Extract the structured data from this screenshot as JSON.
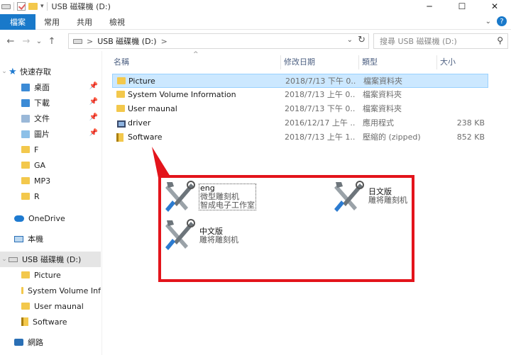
{
  "window": {
    "title": "USB 磁碟機 (D:)",
    "minimize": "─",
    "maximize": "☐",
    "close": "✕"
  },
  "ribbon": {
    "tabs": [
      "檔案",
      "常用",
      "共用",
      "檢視"
    ]
  },
  "nav": {
    "back": "←",
    "forward": "→",
    "recent": "⌄",
    "up": "↑",
    "address_label": "USB 磁碟機 (D:)",
    "address_sep": ">",
    "search_placeholder": "搜尋 USB 磁碟機 (D:)"
  },
  "sidebar": {
    "quick_access": "快速存取",
    "items": [
      "桌面",
      "下載",
      "文件",
      "圖片",
      "F",
      "GA",
      "MP3",
      "R"
    ],
    "onedrive": "OneDrive",
    "this_pc": "本機",
    "usb": "USB 磁碟機 (D:)",
    "usb_children": [
      "Picture",
      "System Volume Inf",
      "User maunal",
      "Software"
    ],
    "network": "網路"
  },
  "columns": {
    "name": "名稱",
    "date": "修改日期",
    "type": "類型",
    "size": "大小"
  },
  "files": [
    {
      "name": "Picture",
      "date": "2018/7/13 下午 0...",
      "type": "檔案資料夾",
      "size": "",
      "icon": "folder-icon"
    },
    {
      "name": "System Volume Information",
      "date": "2018/7/13 上午 0...",
      "type": "檔案資料夾",
      "size": "",
      "icon": "folder-icon"
    },
    {
      "name": "User maunal",
      "date": "2018/7/13 下午 0...",
      "type": "檔案資料夾",
      "size": "",
      "icon": "folder-icon"
    },
    {
      "name": "driver",
      "date": "2016/12/17 上午 ...",
      "type": "應用程式",
      "size": "238 KB",
      "icon": "application-icon"
    },
    {
      "name": "Software",
      "date": "2018/7/13 上午 1...",
      "type": "壓縮的 (zipped)",
      "size": "852 KB",
      "icon": "zip-folder-icon"
    }
  ],
  "callout": {
    "border_color": "#e3141b",
    "tools": [
      {
        "title": "eng",
        "line1": "微型雕刻机",
        "line2": "智成电子工作室"
      },
      {
        "title": "日文版",
        "line1": "雕将雕刻机"
      },
      {
        "title": "中文版",
        "line1": "雕将雕刻机"
      }
    ]
  },
  "colors": {
    "accent": "#1979ca",
    "selection": "#cce8ff"
  }
}
